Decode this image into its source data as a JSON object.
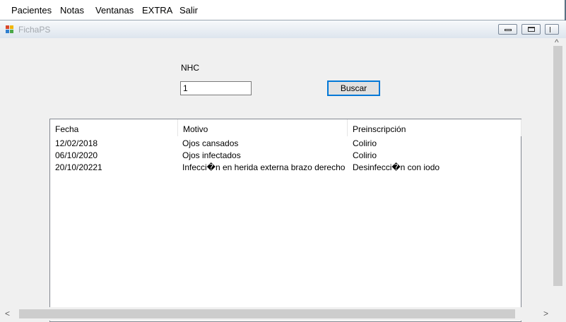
{
  "menubar": {
    "items": [
      "Pacientes",
      "Notas",
      "Ventanas",
      "EXTRA",
      "Salir"
    ]
  },
  "window": {
    "title": "FichaPS",
    "icon": "app-icon"
  },
  "form": {
    "nhc_label": "NHC",
    "nhc_value": "1",
    "search_button": "Buscar"
  },
  "table": {
    "columns": [
      "Fecha",
      "Motivo",
      "Preinscripción"
    ],
    "rows": [
      [
        "12/02/2018",
        "Ojos cansados",
        "Colirio"
      ],
      [
        "06/10/2020",
        "Ojos infectados",
        "Colirio"
      ],
      [
        "20/10/20221",
        "Infecci�n en herida externa brazo derecho",
        "Desinfecci�n con iodo"
      ]
    ]
  },
  "scrollbars": {
    "left_arrow": "<",
    "right_arrow": ">",
    "up_arrow": "^"
  }
}
